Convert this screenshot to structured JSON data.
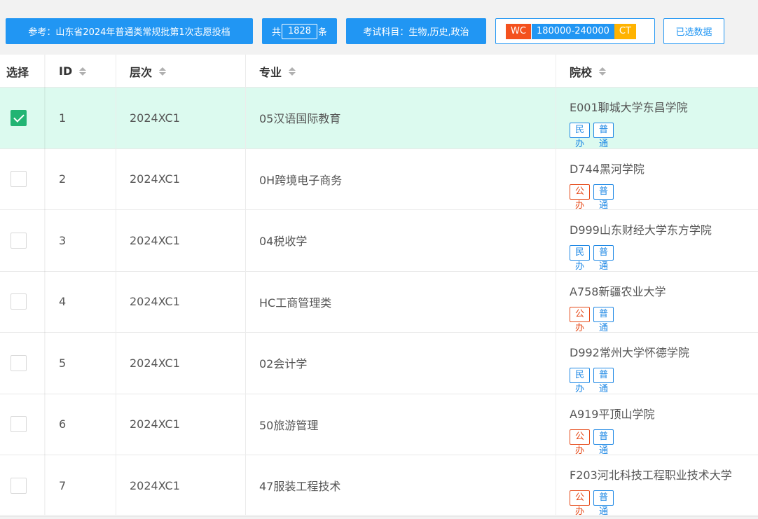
{
  "toolbar": {
    "reference": "参考：山东省2024年普通类常规批第1次志愿投档",
    "total_prefix": "共",
    "total_count": "1828",
    "total_suffix": "条",
    "subjects": "考试科目：生物,历史,政治",
    "wc_label": "WC",
    "wc_range": "180000-240000",
    "ct_label": "CT",
    "selected_data": "已选数据"
  },
  "table": {
    "headers": {
      "select": "选择",
      "id": "ID",
      "level": "层次",
      "major": "专业",
      "school": "院校"
    },
    "rows": [
      {
        "id": "1",
        "level": "2024XC1",
        "major": "05汉语国际教育",
        "school": "E001聊城大学东昌学院",
        "tag1": "民办",
        "tag1_type": "blue",
        "tag2": "普通",
        "checked": true
      },
      {
        "id": "2",
        "level": "2024XC1",
        "major": "0H跨境电子商务",
        "school": "D744黑河学院",
        "tag1": "公办",
        "tag1_type": "red",
        "tag2": "普通",
        "checked": false
      },
      {
        "id": "3",
        "level": "2024XC1",
        "major": "04税收学",
        "school": "D999山东财经大学东方学院",
        "tag1": "民办",
        "tag1_type": "blue",
        "tag2": "普通",
        "checked": false
      },
      {
        "id": "4",
        "level": "2024XC1",
        "major": "HC工商管理类",
        "school": "A758新疆农业大学",
        "tag1": "公办",
        "tag1_type": "red",
        "tag2": "普通",
        "checked": false
      },
      {
        "id": "5",
        "level": "2024XC1",
        "major": "02会计学",
        "school": "D992常州大学怀德学院",
        "tag1": "民办",
        "tag1_type": "blue",
        "tag2": "普通",
        "checked": false
      },
      {
        "id": "6",
        "level": "2024XC1",
        "major": "50旅游管理",
        "school": "A919平顶山学院",
        "tag1": "公办",
        "tag1_type": "red",
        "tag2": "普通",
        "checked": false
      },
      {
        "id": "7",
        "level": "2024XC1",
        "major": "47服装工程技术",
        "school": "F203河北科技工程职业技术大学",
        "tag1": "公办",
        "tag1_type": "red",
        "tag2": "普通",
        "checked": false
      }
    ]
  }
}
